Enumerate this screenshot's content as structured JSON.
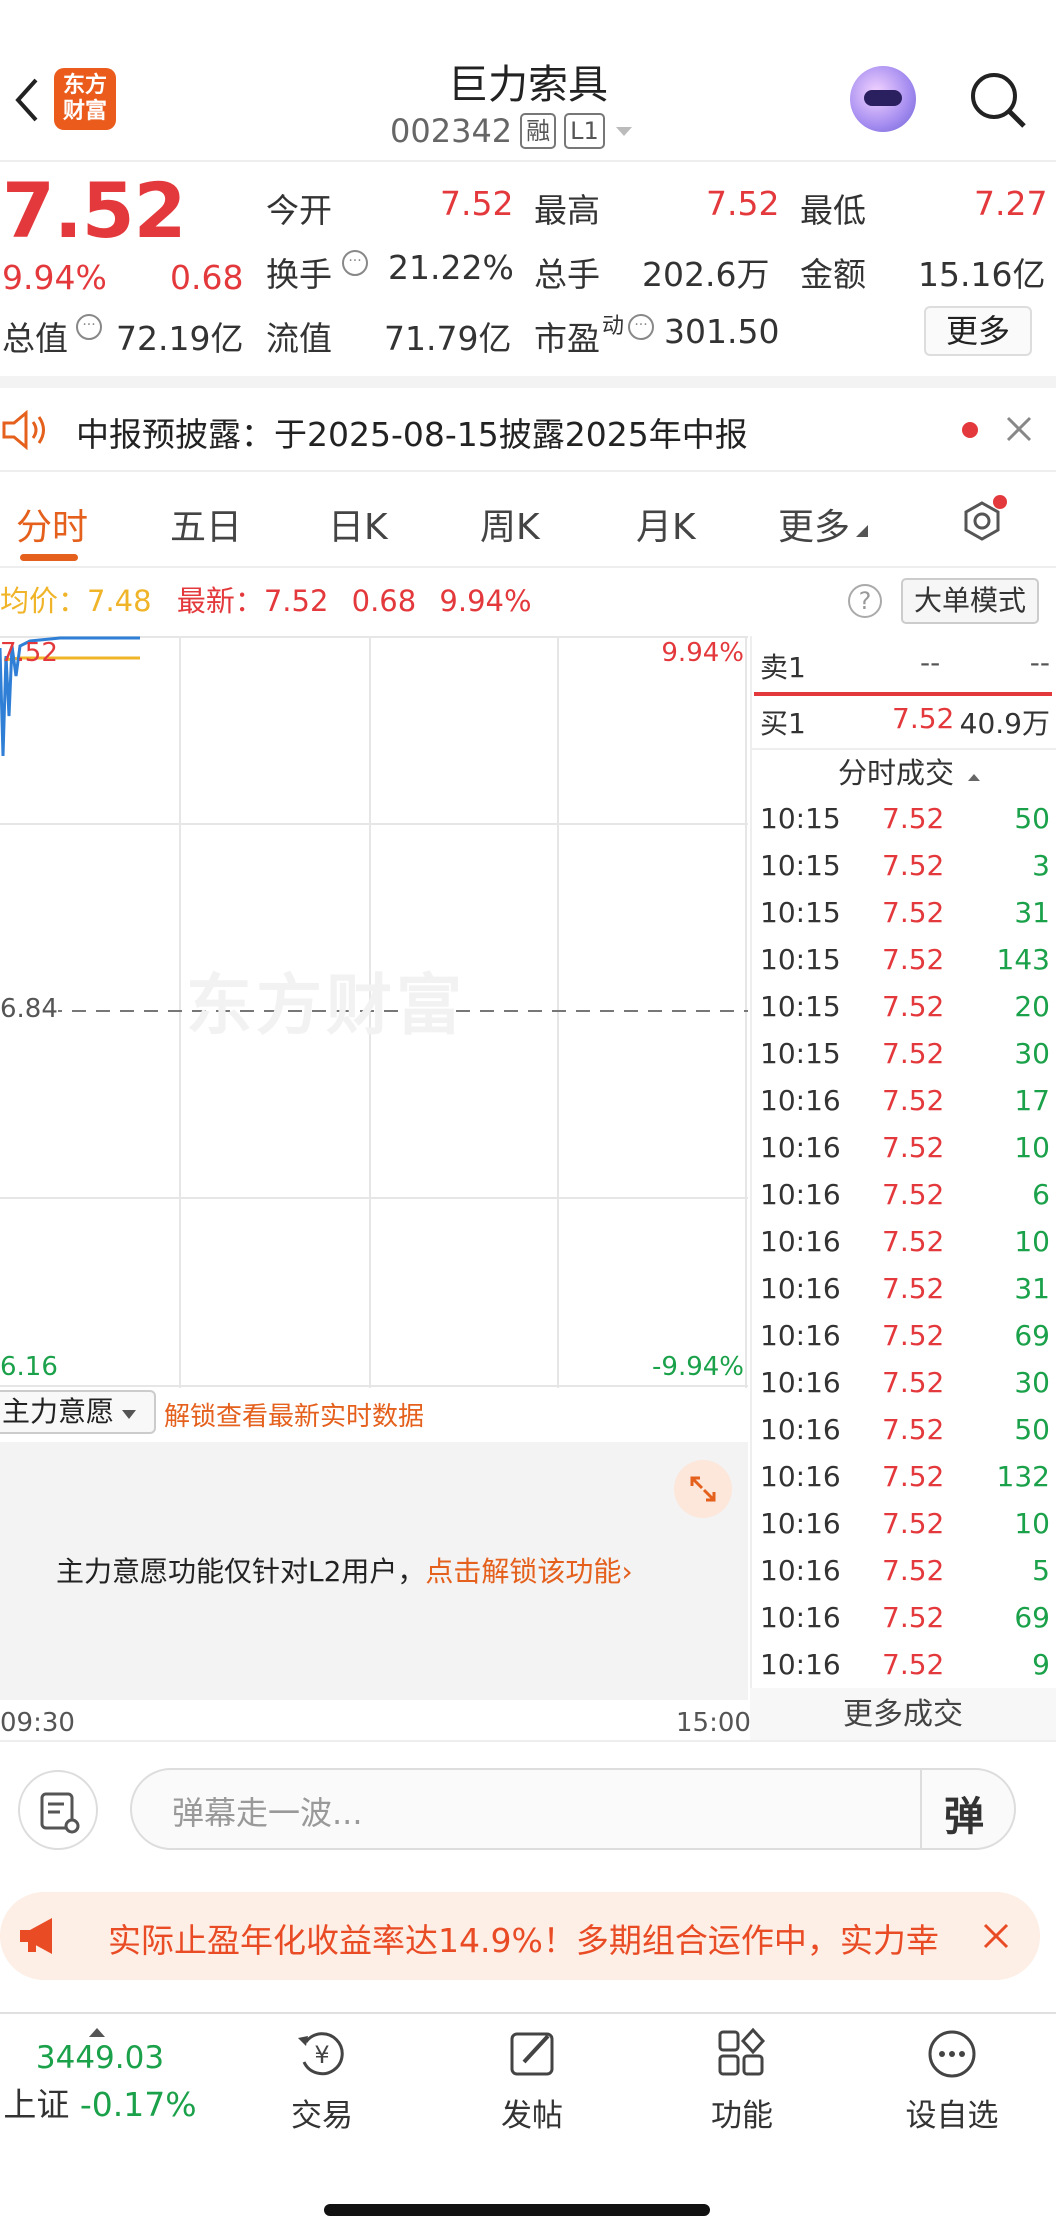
{
  "header": {
    "title": "巨力索具",
    "code": "002342",
    "tag_margin": "融",
    "tag_level": "L1",
    "logo_text_1": "东方",
    "logo_text_2": "财富"
  },
  "quote": {
    "price": "7.52",
    "change_pct": "9.94%",
    "change": "0.68",
    "open_label": "今开",
    "open": "7.52",
    "high_label": "最高",
    "high": "7.52",
    "low_label": "最低",
    "low": "7.27",
    "turnover_label": "换手",
    "turnover": "21.22%",
    "volume_label": "总手",
    "volume": "202.6万",
    "amount_label": "金额",
    "amount": "15.16亿",
    "mcap_label": "总值",
    "mcap": "72.19亿",
    "float_label": "流值",
    "float_cap": "71.79亿",
    "pe_label": "市盈",
    "pe_sup": "动",
    "pe": "301.50",
    "more": "更多"
  },
  "notice": {
    "text": "中报预披露：于2025-08-15披露2025年中报"
  },
  "tabs": [
    "分时",
    "五日",
    "日K",
    "周K",
    "月K",
    "更多"
  ],
  "info": {
    "avg_label": "均价：",
    "avg": "7.48",
    "latest_label": "最新：",
    "latest": "7.52",
    "latest_change": "0.68",
    "latest_pct": "9.94%",
    "mode": "大单模式",
    "help": "?"
  },
  "chart": {
    "top_left": "7.52",
    "top_right": "9.94%",
    "mid_left": "6.84",
    "bottom_left": "6.16",
    "bottom_right": "-9.94%",
    "time_start": "09:30",
    "time_end": "15:00",
    "watermark": "东方财富"
  },
  "orderbook": {
    "sell_label": "卖1",
    "sell_price": "--",
    "sell_vol": "--",
    "buy_label": "买1",
    "buy_price": "7.52",
    "buy_vol": "40.9万"
  },
  "trades_title": "分时成交",
  "trades": [
    {
      "t": "10:15",
      "p": "7.52",
      "v": "50"
    },
    {
      "t": "10:15",
      "p": "7.52",
      "v": "3"
    },
    {
      "t": "10:15",
      "p": "7.52",
      "v": "31"
    },
    {
      "t": "10:15",
      "p": "7.52",
      "v": "143"
    },
    {
      "t": "10:15",
      "p": "7.52",
      "v": "20"
    },
    {
      "t": "10:15",
      "p": "7.52",
      "v": "30"
    },
    {
      "t": "10:16",
      "p": "7.52",
      "v": "17"
    },
    {
      "t": "10:16",
      "p": "7.52",
      "v": "10"
    },
    {
      "t": "10:16",
      "p": "7.52",
      "v": "6"
    },
    {
      "t": "10:16",
      "p": "7.52",
      "v": "10"
    },
    {
      "t": "10:16",
      "p": "7.52",
      "v": "31"
    },
    {
      "t": "10:16",
      "p": "7.52",
      "v": "69"
    },
    {
      "t": "10:16",
      "p": "7.52",
      "v": "30"
    },
    {
      "t": "10:16",
      "p": "7.52",
      "v": "50"
    },
    {
      "t": "10:16",
      "p": "7.52",
      "v": "132"
    },
    {
      "t": "10:16",
      "p": "7.52",
      "v": "10"
    },
    {
      "t": "10:16",
      "p": "7.52",
      "v": "5"
    },
    {
      "t": "10:16",
      "p": "7.52",
      "v": "69"
    },
    {
      "t": "10:16",
      "p": "7.52",
      "v": "9"
    }
  ],
  "more_trades": "更多成交",
  "intent": {
    "dropdown": "主力意愿",
    "unlock_hint": "解锁查看最新实时数据",
    "message": "主力意愿功能仅针对L2用户，",
    "link": "点击解锁该功能"
  },
  "comment": {
    "placeholder": "弹幕走一波...",
    "danmu": "弹"
  },
  "ad": {
    "text": "实际止盈年化收益率达14.9%！多期组合运作中，实力幸"
  },
  "nav": {
    "index_value": "3449.03",
    "index_name": "上证",
    "index_change": "-0.17%",
    "trade": "交易",
    "post": "发帖",
    "features": "功能",
    "watchlist": "设自选"
  },
  "colors": {
    "up": "#e4393c",
    "down": "#1aa14a",
    "accent": "#e4601c",
    "avg_line": "#f0b429",
    "price_line": "#2f7fd6"
  }
}
